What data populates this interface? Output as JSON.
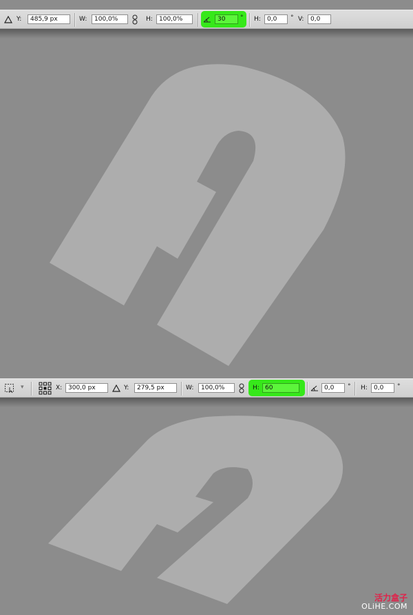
{
  "top_bar": {
    "y_label": "Y:",
    "y_value": "485,9 px",
    "w_label": "W:",
    "w_value": "100,0%",
    "h_label": "H:",
    "h_value": "100,0%",
    "angle_value": "30",
    "angle_unit": "°",
    "hskew_label": "H:",
    "hskew_value": "0,0",
    "hskew_unit": "°",
    "vskew_label": "V:",
    "vskew_value": "0,0"
  },
  "bottom_bar": {
    "x_label": "X:",
    "x_value": "300,0 px",
    "y_label": "Y:",
    "y_value": "279,5 px",
    "w_label": "W:",
    "w_value": "100,0%",
    "h_label": "H:",
    "h_value": "60",
    "angle_value": "0,0",
    "angle_unit": "°",
    "hskew_label": "H:",
    "hskew_value": "0,0",
    "hskew_unit": "°"
  },
  "watermark": {
    "chinese": "活力盒子",
    "site": "OLiHE.COM"
  },
  "colors": {
    "canvas": "#8c8c8c",
    "shape": "#adadad",
    "highlight": "#36e81a",
    "watermark_red": "#e0224a"
  }
}
